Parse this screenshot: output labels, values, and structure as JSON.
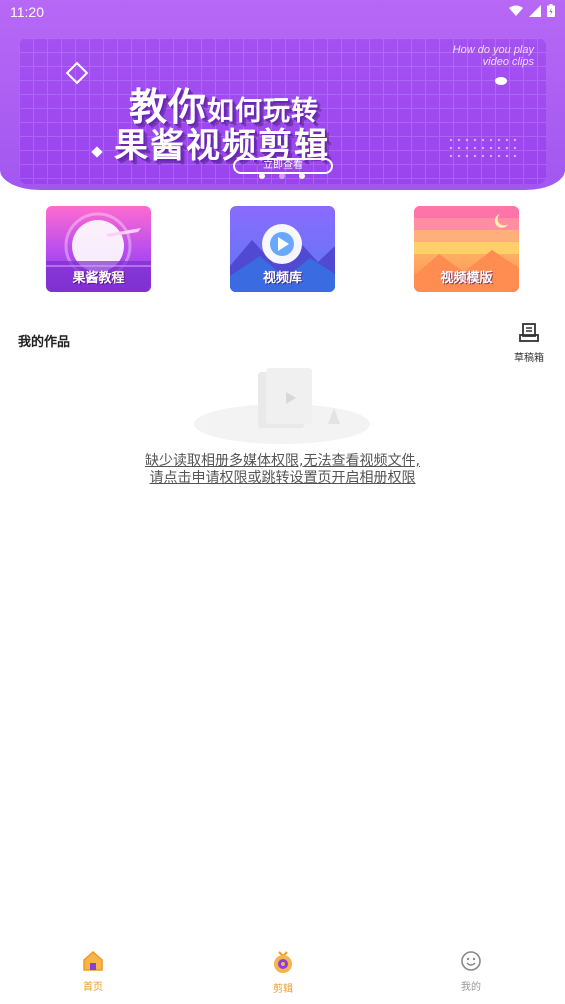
{
  "status_bar": {
    "time": "11:20"
  },
  "banner": {
    "subtitle_line1": "How do you play",
    "subtitle_line2": "video clips",
    "title_big1": "教你",
    "title_small": "如何玩转",
    "title_line2": "果酱视频剪辑",
    "cta": "立即查看",
    "carousel_total": 3,
    "carousel_active": 2
  },
  "tiles": [
    {
      "label": "果酱教程"
    },
    {
      "label": "视频库"
    },
    {
      "label": "视频模版"
    }
  ],
  "works": {
    "title": "我的作品",
    "drafts_label": "草稿箱"
  },
  "empty_state": {
    "line1": "缺少读取相册多媒体权限,无法查看视频文件,",
    "line2": "请点击申请权限或跳转设置页开启相册权限"
  },
  "bottom_nav": {
    "items": [
      {
        "label": "首页",
        "color": "#f29a1d"
      },
      {
        "label": "剪辑",
        "color": "#f29a1d"
      },
      {
        "label": "我的",
        "color": "#999999"
      }
    ]
  },
  "colors": {
    "hero": "#a257ef",
    "accent": "#f29a1d"
  }
}
